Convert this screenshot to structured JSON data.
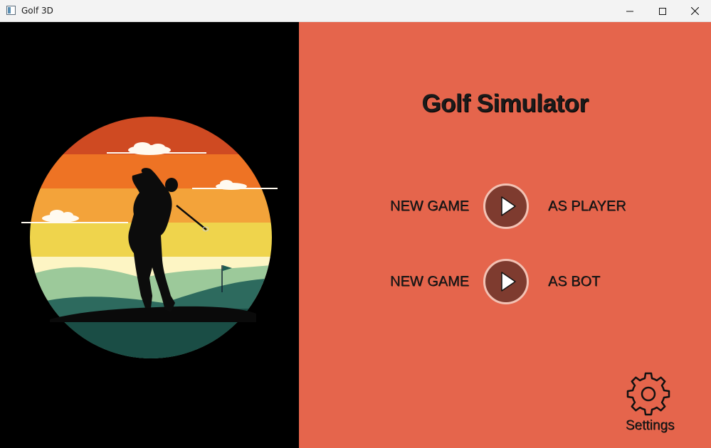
{
  "window": {
    "title": "Golf 3D",
    "icon": "app-window-icon",
    "controls": [
      "minimize-icon",
      "maximize-icon",
      "close-icon"
    ]
  },
  "hero_image": {
    "description_icon": "golfer-silhouette-sunset-illustration"
  },
  "menu": {
    "title": "Golf Simulator",
    "rows": [
      {
        "left_label": "NEW GAME",
        "right_label": "AS PLAYER",
        "icon": "play-icon"
      },
      {
        "left_label": "NEW GAME",
        "right_label": "AS BOT",
        "icon": "play-icon"
      }
    ],
    "settings_label": "Settings",
    "settings_icon": "gear-icon"
  },
  "colors": {
    "panel_background": "#e5654c",
    "button_fill": "#7e3b2f",
    "button_ring": "#f2c2b4",
    "text": "#1a1a1a"
  }
}
